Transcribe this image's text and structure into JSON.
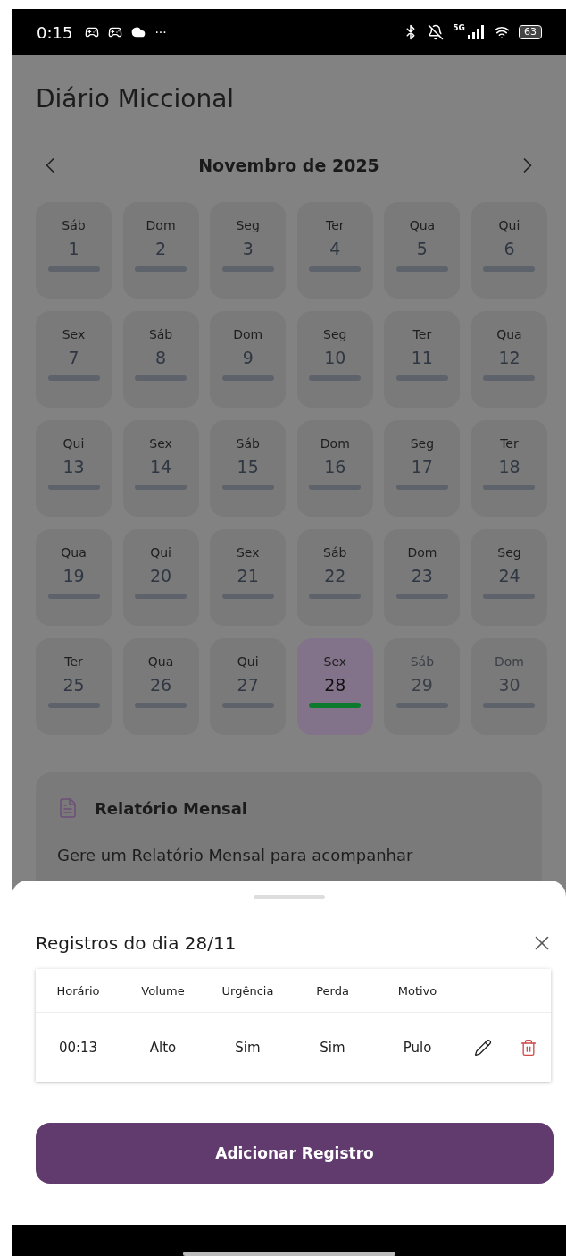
{
  "status_bar": {
    "time": "0:15",
    "more": "···",
    "network": "5G",
    "battery": "63"
  },
  "title": "Diário Miccional",
  "calendar": {
    "month": "Novembro de 2025",
    "days": [
      {
        "weekday": "Sáb",
        "day": "1",
        "selected": false,
        "disabled": false,
        "has_records": false
      },
      {
        "weekday": "Dom",
        "day": "2",
        "selected": false,
        "disabled": false,
        "has_records": false
      },
      {
        "weekday": "Seg",
        "day": "3",
        "selected": false,
        "disabled": false,
        "has_records": false
      },
      {
        "weekday": "Ter",
        "day": "4",
        "selected": false,
        "disabled": false,
        "has_records": false
      },
      {
        "weekday": "Qua",
        "day": "5",
        "selected": false,
        "disabled": false,
        "has_records": false
      },
      {
        "weekday": "Qui",
        "day": "6",
        "selected": false,
        "disabled": false,
        "has_records": false
      },
      {
        "weekday": "Sex",
        "day": "7",
        "selected": false,
        "disabled": false,
        "has_records": false
      },
      {
        "weekday": "Sáb",
        "day": "8",
        "selected": false,
        "disabled": false,
        "has_records": false
      },
      {
        "weekday": "Dom",
        "day": "9",
        "selected": false,
        "disabled": false,
        "has_records": false
      },
      {
        "weekday": "Seg",
        "day": "10",
        "selected": false,
        "disabled": false,
        "has_records": false
      },
      {
        "weekday": "Ter",
        "day": "11",
        "selected": false,
        "disabled": false,
        "has_records": false
      },
      {
        "weekday": "Qua",
        "day": "12",
        "selected": false,
        "disabled": false,
        "has_records": false
      },
      {
        "weekday": "Qui",
        "day": "13",
        "selected": false,
        "disabled": false,
        "has_records": false
      },
      {
        "weekday": "Sex",
        "day": "14",
        "selected": false,
        "disabled": false,
        "has_records": false
      },
      {
        "weekday": "Sáb",
        "day": "15",
        "selected": false,
        "disabled": false,
        "has_records": false
      },
      {
        "weekday": "Dom",
        "day": "16",
        "selected": false,
        "disabled": false,
        "has_records": false
      },
      {
        "weekday": "Seg",
        "day": "17",
        "selected": false,
        "disabled": false,
        "has_records": false
      },
      {
        "weekday": "Ter",
        "day": "18",
        "selected": false,
        "disabled": false,
        "has_records": false
      },
      {
        "weekday": "Qua",
        "day": "19",
        "selected": false,
        "disabled": false,
        "has_records": false
      },
      {
        "weekday": "Qui",
        "day": "20",
        "selected": false,
        "disabled": false,
        "has_records": false
      },
      {
        "weekday": "Sex",
        "day": "21",
        "selected": false,
        "disabled": false,
        "has_records": false
      },
      {
        "weekday": "Sáb",
        "day": "22",
        "selected": false,
        "disabled": false,
        "has_records": false
      },
      {
        "weekday": "Dom",
        "day": "23",
        "selected": false,
        "disabled": false,
        "has_records": false
      },
      {
        "weekday": "Seg",
        "day": "24",
        "selected": false,
        "disabled": false,
        "has_records": false
      },
      {
        "weekday": "Ter",
        "day": "25",
        "selected": false,
        "disabled": false,
        "has_records": false
      },
      {
        "weekday": "Qua",
        "day": "26",
        "selected": false,
        "disabled": false,
        "has_records": false
      },
      {
        "weekday": "Qui",
        "day": "27",
        "selected": false,
        "disabled": false,
        "has_records": false
      },
      {
        "weekday": "Sex",
        "day": "28",
        "selected": true,
        "disabled": false,
        "has_records": true
      },
      {
        "weekday": "Sáb",
        "day": "29",
        "selected": false,
        "disabled": true,
        "has_records": false
      },
      {
        "weekday": "Dom",
        "day": "30",
        "selected": false,
        "disabled": true,
        "has_records": false
      }
    ]
  },
  "report_card": {
    "title": "Relatório Mensal",
    "text": "Gere um Relatório Mensal para acompanhar"
  },
  "sheet": {
    "title": "Registros do dia 28/11",
    "table": {
      "columns": [
        "Horário",
        "Volume",
        "Urgência",
        "Perda",
        "Motivo"
      ],
      "rows": [
        {
          "cells": [
            "00:13",
            "Alto",
            "Sim",
            "Sim",
            "Pulo"
          ]
        }
      ]
    },
    "button": "Adicionar Registro"
  }
}
